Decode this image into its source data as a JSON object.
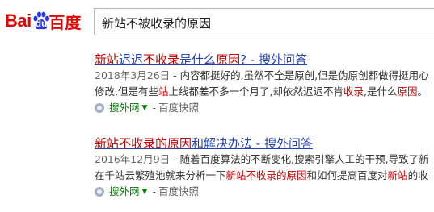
{
  "header": {
    "logo": {
      "bai": "Bai",
      "du": "du",
      "zh": "百度"
    },
    "search_value": "新站不被收录的原因"
  },
  "results": [
    {
      "title_parts": [
        {
          "text": "新站",
          "em": true
        },
        {
          "text": "迟迟",
          "em": false
        },
        {
          "text": "不收录",
          "em": true
        },
        {
          "text": "是什么",
          "em": false
        },
        {
          "text": "原因",
          "em": true
        },
        {
          "text": "? - 搜外问答",
          "em": false
        }
      ],
      "line1": {
        "date": "2018年3月26日",
        "text": " - 内容都挺好的,虽然不全是原创,但是伪原创都做得挺用心"
      },
      "line2_parts": [
        {
          "text": "修改,但是有些",
          "em": false
        },
        {
          "text": "站",
          "em": true
        },
        {
          "text": "上线都差不多一个月了,却依然迟迟不肯",
          "em": false
        },
        {
          "text": "收录",
          "em": true
        },
        {
          "text": ",是什么",
          "em": false
        },
        {
          "text": "原因",
          "em": true
        },
        {
          "text": "。",
          "em": false
        }
      ],
      "source": {
        "name": "搜外网",
        "arrow": "▼",
        "sep": "-",
        "snapshot": "百度快照"
      }
    },
    {
      "title_parts": [
        {
          "text": "新站不收录的原因",
          "em": true
        },
        {
          "text": "和解决办法 - 搜外问答",
          "em": false
        }
      ],
      "line1": {
        "date": "2016年12月9日",
        "text": " - 随着百度算法的不断变化,搜索引擎人工的干预,导致了新"
      },
      "line2_parts": [
        {
          "text": "在千站云繁殖池就来分析一下",
          "em": false
        },
        {
          "text": "新站不收录的原因",
          "em": true
        },
        {
          "text": "和如何提高百度对",
          "em": false
        },
        {
          "text": "新站",
          "em": true
        },
        {
          "text": "的收",
          "em": false
        }
      ],
      "source": {
        "name": "搜外网",
        "arrow": "▼",
        "sep": "-",
        "snapshot": "百度快照"
      }
    }
  ]
}
